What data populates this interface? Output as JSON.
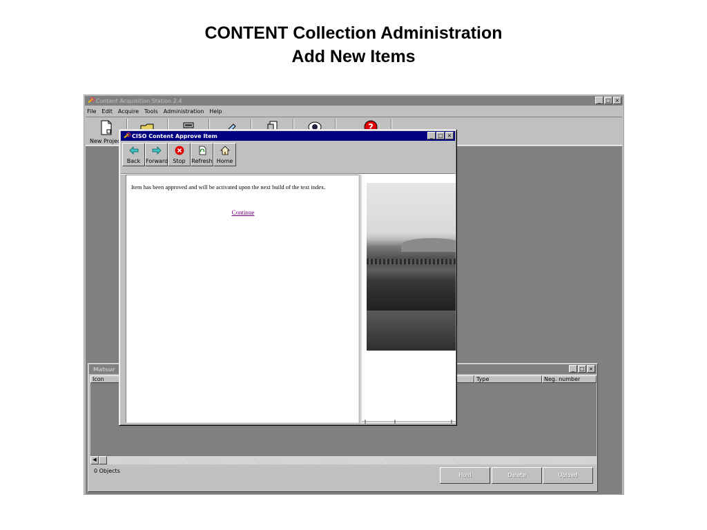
{
  "slide": {
    "title_line1": "CONTENT Collection Administration",
    "title_line2": "Add New Items"
  },
  "app": {
    "title": "Content Acquisition Station 2.4",
    "menu": [
      "File",
      "Edit",
      "Acquire",
      "Tools",
      "Administration",
      "Help"
    ],
    "toolbar": {
      "new_project_label": "New Projec"
    }
  },
  "inner_window": {
    "title": "Matsur",
    "columns": [
      "Icon",
      "Type",
      "Neg. number"
    ],
    "status": "0 Objects",
    "buttons": {
      "hold": "Hold",
      "delete": "Delete",
      "upload": "Upload"
    }
  },
  "dialog": {
    "title": "CISO Content Approve Item",
    "nav": {
      "back": "Back",
      "forward": "Forward",
      "stop": "Stop",
      "refresh": "Refresh",
      "home": "Home"
    },
    "message": "Item has been approved and will be activated upon the next build of the text index.",
    "continue_link": "Continue"
  },
  "colors": {
    "active_titlebar": "#000080",
    "inactive_titlebar": "#808080",
    "link_visited": "#800080",
    "stop_icon": "#e00000"
  }
}
